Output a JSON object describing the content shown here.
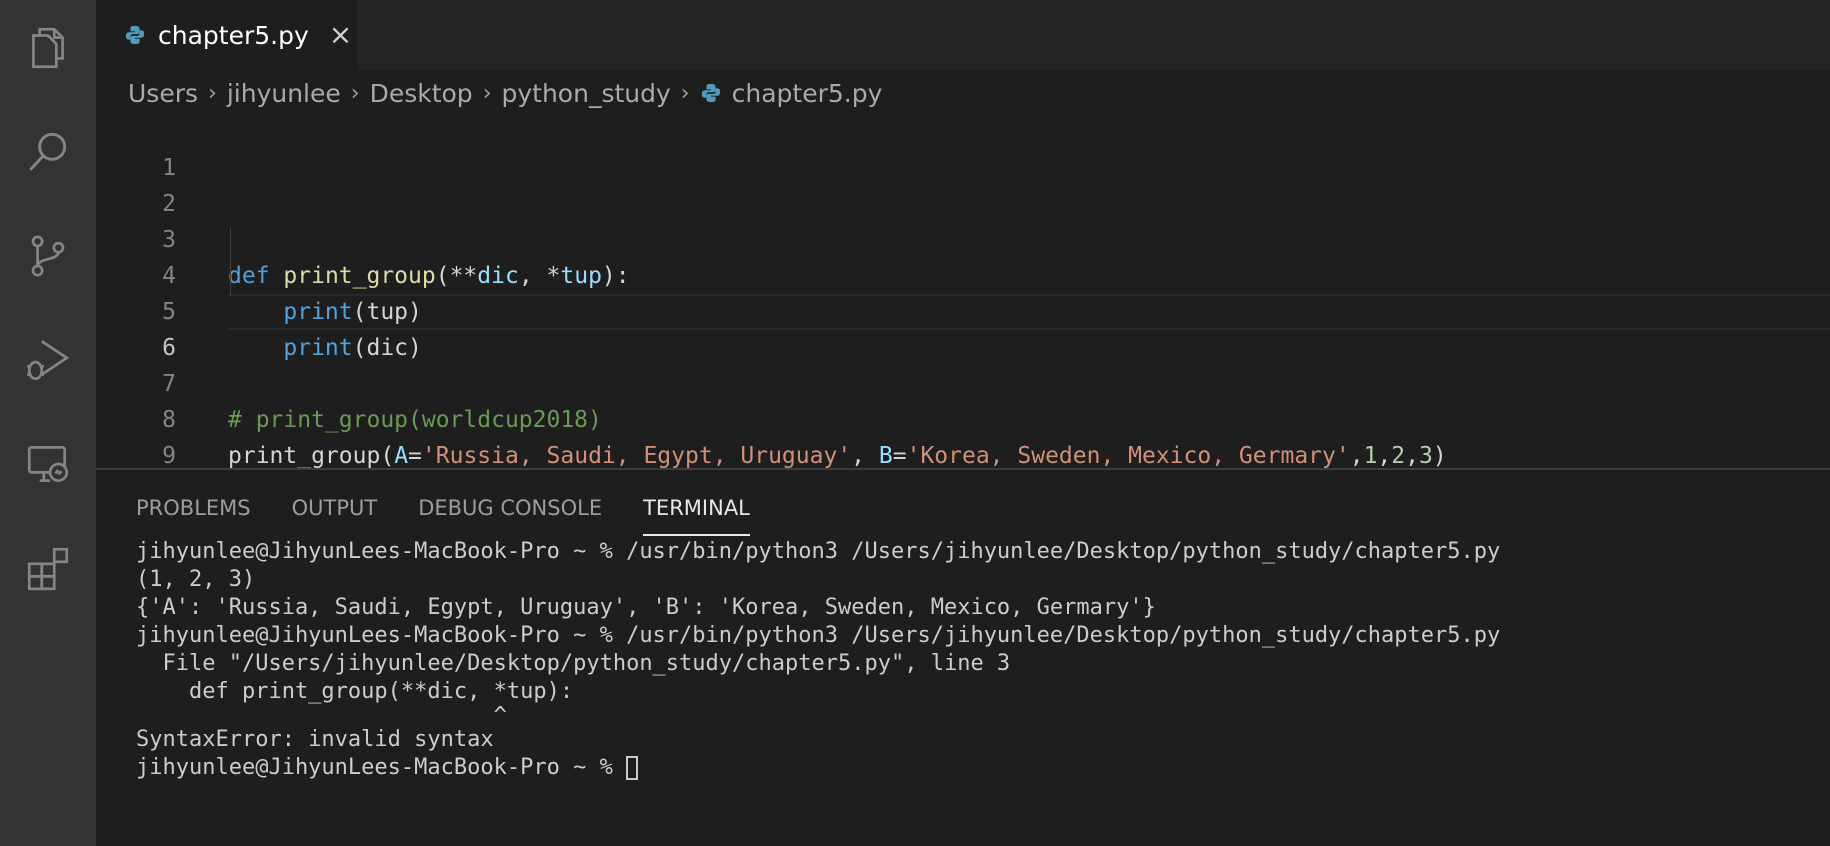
{
  "tab": {
    "title": "chapter5.py",
    "close": "×"
  },
  "breadcrumb": [
    "Users",
    "jihyunlee",
    "Desktop",
    "python_study",
    "chapter5.py"
  ],
  "breadcrumb_sep": "›",
  "editor": {
    "line_numbers": [
      "1",
      "2",
      "3",
      "4",
      "5",
      "6",
      "7",
      "8",
      "9"
    ],
    "line3": {
      "kw": "def",
      "fn": "print_group",
      "p1": "(**",
      "param1": "dic",
      "p2": ", *",
      "param2": "tup",
      "p3": "):"
    },
    "line4": {
      "indent": "    ",
      "fn": "print",
      "rest": "(tup)"
    },
    "line5": {
      "indent": "    ",
      "fn": "print",
      "rest": "(dic)"
    },
    "line7": {
      "comment": "# print_group(worldcup2018)"
    },
    "line8": {
      "fn": "print_group",
      "p1": "(",
      "a": "A",
      "eq1": "=",
      "s1": "'Russia, Saudi, Egypt, Uruguay'",
      "c1": ", ",
      "b": "B",
      "eq2": "=",
      "s2": "'Korea, Sweden, Mexico, Germary'",
      "c2": ",",
      "n1": "1",
      "c3": ",",
      "n2": "2",
      "c4": ",",
      "n3": "3",
      "p2": ")"
    }
  },
  "panel": {
    "tabs": [
      "PROBLEMS",
      "OUTPUT",
      "DEBUG CONSOLE",
      "TERMINAL"
    ],
    "active_tab": "TERMINAL"
  },
  "terminal": {
    "lines": [
      "jihyunlee@JihyunLees-MacBook-Pro ~ % /usr/bin/python3 /Users/jihyunlee/Desktop/python_study/chapter5.py",
      "(1, 2, 3)",
      "{'A': 'Russia, Saudi, Egypt, Uruguay', 'B': 'Korea, Sweden, Mexico, Germary'}",
      "jihyunlee@JihyunLees-MacBook-Pro ~ % /usr/bin/python3 /Users/jihyunlee/Desktop/python_study/chapter5.py",
      "  File \"/Users/jihyunlee/Desktop/python_study/chapter5.py\", line 3",
      "    def print_group(**dic, *tup):",
      "                           ^",
      "SyntaxError: invalid syntax"
    ],
    "prompt": "jihyunlee@JihyunLees-MacBook-Pro ~ % "
  },
  "icons": {
    "activity": [
      "explorer-icon",
      "search-icon",
      "source-control-icon",
      "run-debug-icon",
      "remote-explorer-icon",
      "extensions-icon"
    ],
    "accent": "#858585"
  }
}
